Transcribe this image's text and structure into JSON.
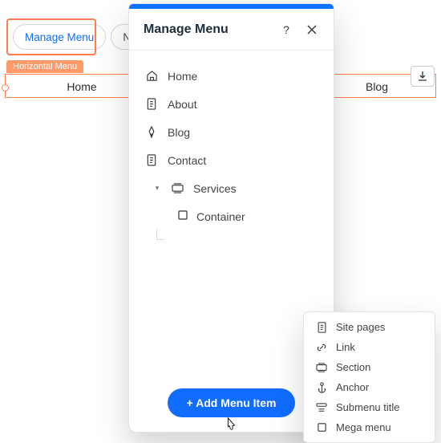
{
  "toolbar": {
    "manage_label": "Manage Menu",
    "nav_label": "Na"
  },
  "canvas": {
    "badge": "Horizontal Menu",
    "items": {
      "home": "Home",
      "blog": "Blog"
    }
  },
  "panel": {
    "title": "Manage Menu",
    "help_label": "?",
    "items": [
      {
        "icon": "home-icon",
        "label": "Home"
      },
      {
        "icon": "page-icon",
        "label": "About"
      },
      {
        "icon": "pen-icon",
        "label": "Blog"
      },
      {
        "icon": "page-icon",
        "label": "Contact"
      },
      {
        "icon": "section-icon",
        "label": "Services",
        "expanded": true,
        "children": [
          {
            "icon": "square-icon",
            "label": "Container"
          }
        ]
      }
    ],
    "add_button": "+ Add Menu Item"
  },
  "popup": {
    "items": [
      {
        "icon": "page-icon",
        "label": "Site pages"
      },
      {
        "icon": "link-icon",
        "label": "Link"
      },
      {
        "icon": "section-icon",
        "label": "Section"
      },
      {
        "icon": "anchor-icon",
        "label": "Anchor"
      },
      {
        "icon": "submenu-icon",
        "label": "Submenu title"
      },
      {
        "icon": "square-icon",
        "label": "Mega menu"
      }
    ]
  }
}
